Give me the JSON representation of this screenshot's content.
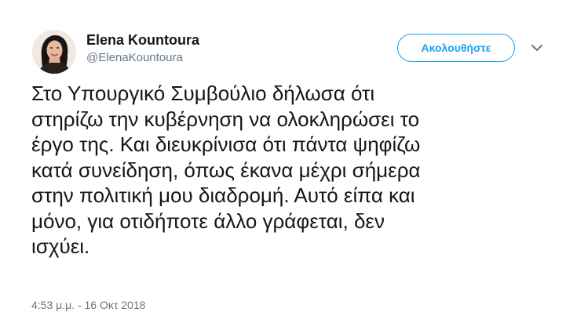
{
  "author": {
    "name": "Elena Kountoura",
    "handle": "@ElenaKountoura",
    "avatar_icon": "profile-photo"
  },
  "actions": {
    "follow_label": "Ακολουθήστε",
    "menu_icon": "chevron-down-icon"
  },
  "tweet": {
    "lines": [
      "Στο Υπουργικό Συμβούλιο δήλωσα ότι",
      "στηρίζω την κυβέρνηση να ολοκληρώσει το",
      "έργο της. Και διευκρίνισα ότι πάντα ψηφίζω",
      "κατά συνείδηση, όπως έκανα μέχρι σήμερα",
      "στην πολιτική μου διαδρομή. Αυτό είπα και",
      "μόνο, για οτιδήποτε άλλο γράφεται, δεν",
      "ισχύει."
    ],
    "timestamp": "4:53 μ.μ. - 16 Οκτ 2018"
  },
  "colors": {
    "accent": "#1da1f2",
    "text": "#14171a",
    "secondary_text": "#657786"
  }
}
